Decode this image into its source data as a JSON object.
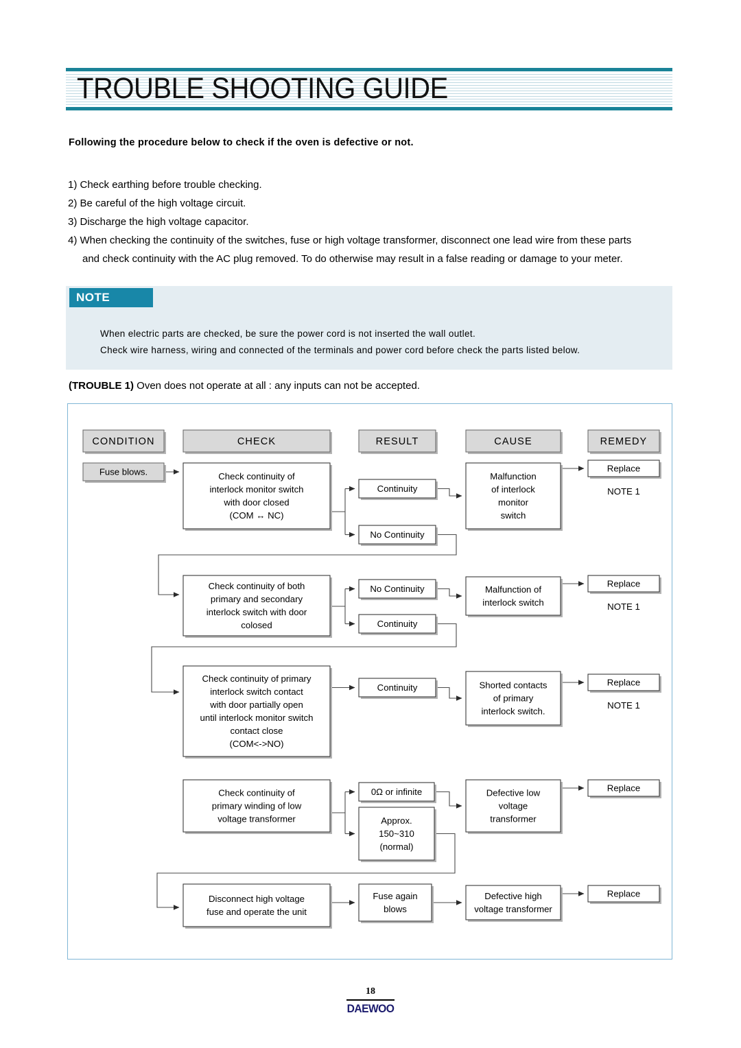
{
  "header": {
    "title": "TROUBLE SHOOTING GUIDE",
    "rule_color": "#1a8398"
  },
  "intro": {
    "heading": "Following the procedure below to check if the oven is defective or not.",
    "steps": [
      "1) Check earthing before trouble checking.",
      "2) Be careful of the high voltage circuit.",
      "3) Discharge the  high voltage capacitor.",
      "4) When checking the continuity of the switches, fuse or high voltage transformer, disconnect one lead wire from these parts",
      "and check continuity with the AC plug removed. To do otherwise may result in a false reading or damage to your meter."
    ]
  },
  "note": {
    "tab_label": "NOTE",
    "tab_color": "#1887a8",
    "background": "#e4edf2",
    "lines": [
      "When electric parts are checked, be sure the power cord is not inserted the wall outlet.",
      "Check wire harness, wiring and connected of the terminals and power cord before check the parts listed below."
    ]
  },
  "trouble": {
    "label": "(TROUBLE 1)",
    "description": "Oven does not operate at all : any inputs can not be accepted."
  },
  "chart_data": {
    "type": "diagram",
    "title": "Trouble 1 diagnostic flowchart",
    "columns": [
      "CONDITION",
      "CHECK",
      "RESULT",
      "CAUSE",
      "REMEDY"
    ],
    "condition": "Fuse blows.",
    "rows": [
      {
        "check": "Check continuity of\ninterlock monitor switch\nwith door closed\n(COM ↔ NC)",
        "results": [
          "Continuity",
          "No Continuity"
        ],
        "cause": "Malfunction\nof interlock\nmonitor\nswitch",
        "remedy": "Replace",
        "remedy_note": "NOTE 1"
      },
      {
        "check": "Check continuity of both\nprimary and secondary\ninterlock switch with door\ncolosed",
        "results": [
          "No Continuity",
          "Continuity"
        ],
        "cause": "Malfunction of\ninterlock switch",
        "remedy": "Replace",
        "remedy_note": "NOTE 1"
      },
      {
        "check": "Check continuity of primary\ninterlock switch contact\nwith door partially open\nuntil interlock monitor switch\ncontact close\n(COM<->NO)",
        "results": [
          "Continuity"
        ],
        "cause": "Shorted contacts\nof primary\ninterlock switch.",
        "remedy": "Replace",
        "remedy_note": "NOTE 1"
      },
      {
        "check": "Check continuity of\nprimary winding of low\nvoltage transformer",
        "results": [
          "0Ω or infinite",
          "Approx.\n150~310\n(normal)"
        ],
        "cause": "Defective low\nvoltage\ntransformer",
        "remedy": "Replace",
        "remedy_note": ""
      },
      {
        "check": "Disconnect high voltage\nfuse and operate the unit",
        "results": [
          "Fuse again\nblows"
        ],
        "cause": "Defective high\nvoltage transformer",
        "remedy": "Replace",
        "remedy_note": ""
      }
    ]
  },
  "footer": {
    "page_number": "18",
    "brand": "DAEWOO",
    "brand_color": "#1c1c6e"
  }
}
